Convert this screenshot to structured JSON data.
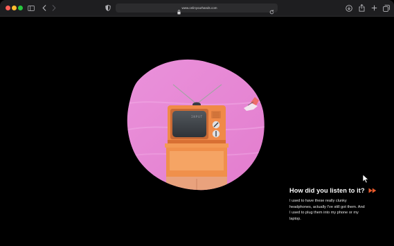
{
  "browser": {
    "url": "www.onlinyourhands.com",
    "colors": {
      "close": "#ff5f57",
      "minimize": "#febc2e",
      "zoom": "#28c840",
      "chrome": "#1e1e20"
    },
    "icons": {
      "sidebar": "sidebar-icon",
      "back": "chevron-left-icon",
      "forward": "chevron-right-icon",
      "privacy": "shield-icon",
      "lock": "lock-icon",
      "reload": "reload-icon",
      "downloads": "download-icon",
      "share": "share-icon",
      "new_tab": "plus-icon",
      "tab_overview": "tabs-icon"
    }
  },
  "caption": {
    "title": "How did you listen to it?",
    "body": "I used to have these really clunky headphones, actually I've still got them. And I used to plug them into my phone or my laptop.",
    "accent_color": "#e85a2c"
  },
  "tv": {
    "screen_text": "INPUT",
    "background_color": "#e98ad6",
    "set_color": "#f08a47"
  }
}
